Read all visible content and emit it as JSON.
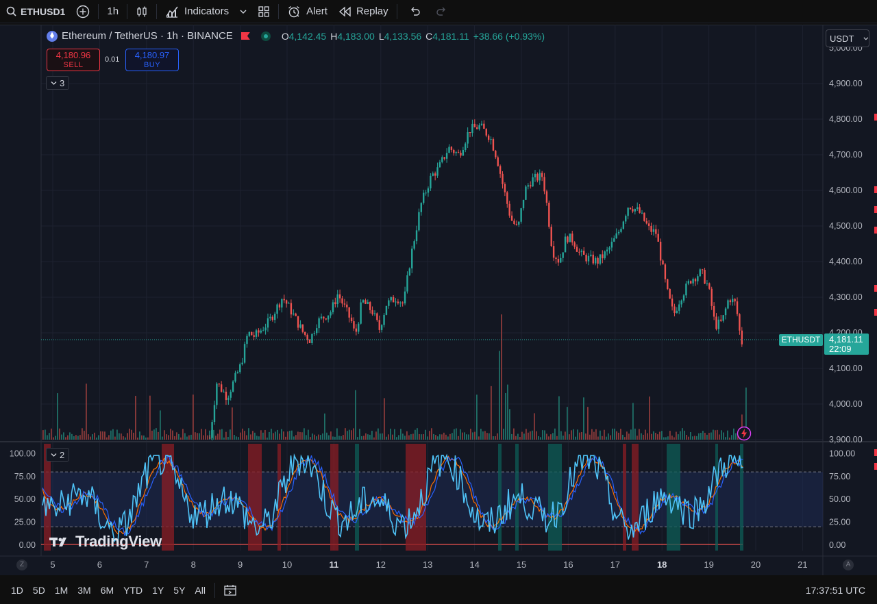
{
  "toolbar": {
    "symbol": "ETHUSD1",
    "interval": "1h",
    "indicators_label": "Indicators",
    "alert_label": "Alert",
    "replay_label": "Replay"
  },
  "legend": {
    "title": "Ethereum / TetherUS · 1h · BINANCE",
    "open_key": "O",
    "open": "4,142.45",
    "high_key": "H",
    "high": "4,183.00",
    "low_key": "L",
    "low": "4,133.56",
    "close_key": "C",
    "close": "4,181.11",
    "change": "+38.66 (+0.93%)"
  },
  "trade": {
    "sell_price": "4,180.96",
    "sell_label": "SELL",
    "buy_price": "4,180.97",
    "buy_label": "BUY",
    "quantity": "0.01"
  },
  "main_pane": {
    "collapsed_count": "3"
  },
  "indicator_pane": {
    "collapsed_count": "2"
  },
  "currency": "USDT",
  "price_tag": {
    "symbol": "ETHUSDT",
    "price": "4,181.11",
    "countdown": "22:09"
  },
  "price_axis": [
    "4,900.00",
    "4,800.00",
    "4,700.00",
    "4,600.00",
    "4,500.00",
    "4,400.00",
    "4,300.00",
    "4,200.00",
    "4,100.00",
    "4,000.00",
    "3,900.00"
  ],
  "price_axis_top_partial": "5,000.00",
  "osc_axis_right": [
    "100.00",
    "75.00",
    "50.00",
    "25.00",
    "0.00"
  ],
  "osc_axis_left": [
    "100.00",
    "75.00",
    "50.00",
    "25.00",
    "0.00"
  ],
  "time_axis": [
    "5",
    "6",
    "7",
    "8",
    "9",
    "10",
    "11",
    "12",
    "13",
    "14",
    "15",
    "16",
    "17",
    "18",
    "19",
    "20",
    "21"
  ],
  "time_axis_bold": [
    "11",
    "18"
  ],
  "watermark": "TradingView",
  "ranges": [
    "1D",
    "5D",
    "1M",
    "3M",
    "6M",
    "YTD",
    "1Y",
    "5Y",
    "All"
  ],
  "clock": "17:37:51 UTC",
  "colors": {
    "up": "#26a69a",
    "down": "#ef5350",
    "k_line": "#2962ff",
    "d_line": "#ff6d00",
    "rsi_line": "#4fc3f7"
  },
  "chart_data": {
    "type": "candlestick",
    "price_range": [
      3880,
      5000
    ],
    "osc_range": [
      0,
      100
    ],
    "osc_bands": [
      20,
      80
    ],
    "last_price": 4181.11
  }
}
